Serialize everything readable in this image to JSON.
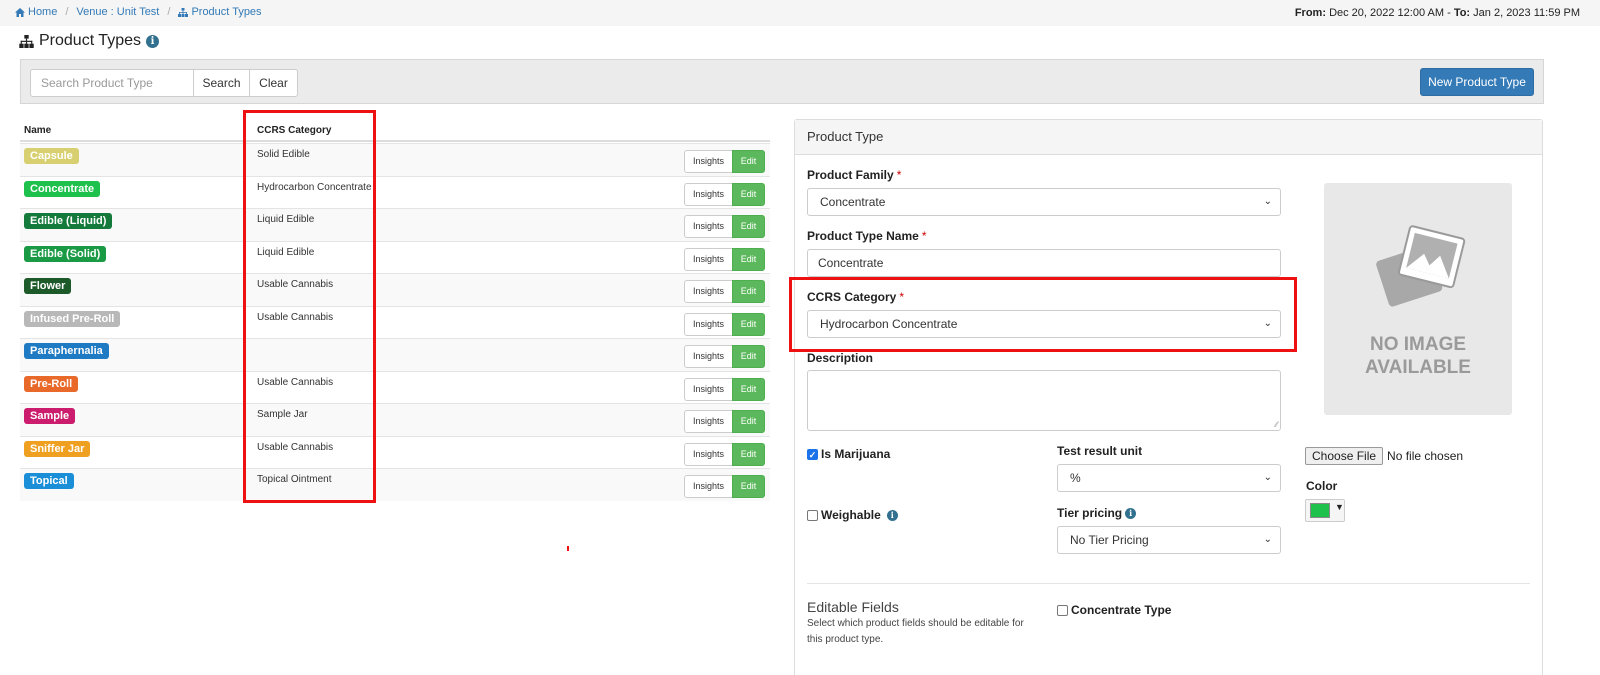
{
  "breadcrumb": {
    "home": "Home",
    "venue": "Venue : Unit Test",
    "current": "Product Types"
  },
  "daterange": {
    "from_label": "From:",
    "from_value": "Dec 20, 2022 12:00 AM",
    "separator": " - ",
    "to_label": "To:",
    "to_value": "Jan 2, 2023 11:59 PM"
  },
  "page": {
    "title": "Product Types"
  },
  "search": {
    "placeholder": "Search Product Type",
    "search_label": "Search",
    "clear_label": "Clear",
    "new_label": "New Product Type"
  },
  "table": {
    "headers": {
      "name": "Name",
      "ccrs": "CCRS Category"
    },
    "insights_label": "Insights",
    "edit_label": "Edit",
    "rows": [
      {
        "name": "Capsule",
        "ccrs": "Solid Edible",
        "color": "#d8d070"
      },
      {
        "name": "Concentrate",
        "ccrs": "Hydrocarbon Concentrate",
        "color": "#1ec14c"
      },
      {
        "name": "Edible (Liquid)",
        "ccrs": "Liquid Edible",
        "color": "#137a3c"
      },
      {
        "name": "Edible (Solid)",
        "ccrs": "Liquid Edible",
        "color": "#1a9a45"
      },
      {
        "name": "Flower",
        "ccrs": "Usable Cannabis",
        "color": "#1d5a2a"
      },
      {
        "name": "Infused Pre-Roll",
        "ccrs": "Usable Cannabis",
        "color": "#b8b8b8"
      },
      {
        "name": "Paraphernalia",
        "ccrs": "",
        "color": "#1f7ac4"
      },
      {
        "name": "Pre-Roll",
        "ccrs": "Usable Cannabis",
        "color": "#e8692a"
      },
      {
        "name": "Sample",
        "ccrs": "Sample Jar",
        "color": "#cc1c6e"
      },
      {
        "name": "Sniffer Jar",
        "ccrs": "Usable Cannabis",
        "color": "#f0a020"
      },
      {
        "name": "Topical",
        "ccrs": "Topical Ointment",
        "color": "#1a8fd8"
      }
    ]
  },
  "form": {
    "panel_title": "Product Type",
    "product_family": {
      "label": "Product Family",
      "required_mark": "*",
      "value": "Concentrate"
    },
    "product_type_name": {
      "label": "Product Type Name",
      "required_mark": "*",
      "value": "Concentrate"
    },
    "ccrs_category": {
      "label": "CCRS Category",
      "required_mark": "*",
      "value": "Hydrocarbon Concentrate"
    },
    "description": {
      "label": "Description"
    },
    "is_marijuana": {
      "label": "Is Marijuana",
      "checked": true
    },
    "weighable": {
      "label": "Weighable",
      "checked": false
    },
    "test_result_unit": {
      "label": "Test result unit",
      "value": "%"
    },
    "tier_pricing": {
      "label": "Tier pricing",
      "value": "No Tier Pricing"
    },
    "no_image": {
      "line1": "NO IMAGE",
      "line2": "AVAILABLE"
    },
    "file": {
      "button_label": "Choose File",
      "status": "No file chosen"
    },
    "color": {
      "label": "Color",
      "value": "#1ec14c"
    },
    "editable_fields": {
      "title": "Editable Fields",
      "help": "Select which product fields should be editable for this product type.",
      "concentrate_type_label": "Concentrate Type"
    }
  }
}
